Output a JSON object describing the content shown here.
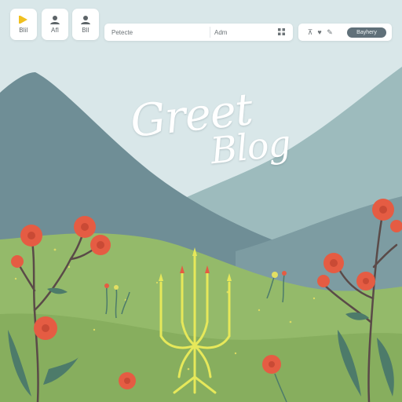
{
  "toolbar": {
    "tiles": [
      {
        "label": "Blil",
        "icon": "play-icon"
      },
      {
        "label": "Afl",
        "icon": "user-icon"
      },
      {
        "label": "Bll",
        "icon": "user-icon"
      }
    ],
    "search_bar": {
      "left_field": "Petecte",
      "right_field": "Adm",
      "icon": "grid-icon"
    },
    "right_group": {
      "icons": [
        "pin-icon",
        "heart-icon",
        "pencil-icon"
      ],
      "button_label": "Bayhery"
    }
  },
  "hero": {
    "title_line1": "Greet",
    "title_line2": "Blog"
  },
  "colors": {
    "sky": "#d7e6e8",
    "mountain_back": "#90b3b6",
    "mountain_front": "#6f8e95",
    "meadow": "#8db562",
    "flower": "#e55c43",
    "candelabra": "#e6e85a"
  }
}
